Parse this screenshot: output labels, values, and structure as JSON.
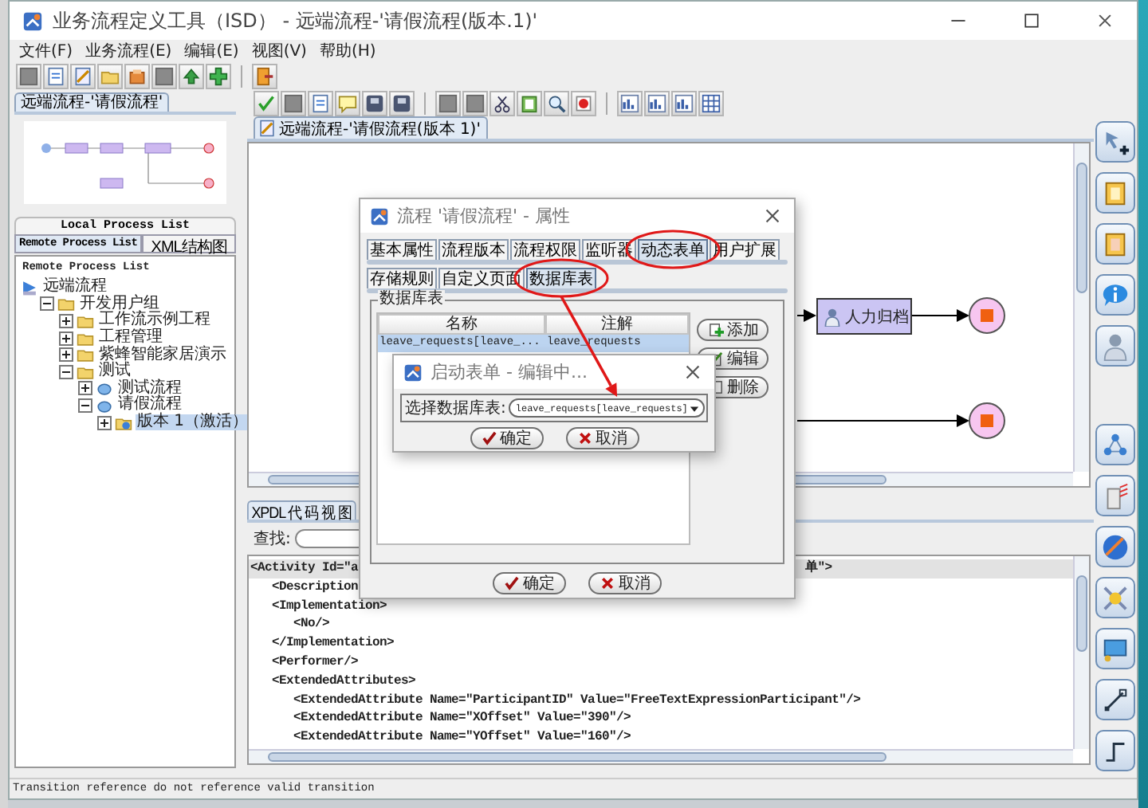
{
  "window": {
    "title": "业务流程定义工具（ISD） - 远端流程-'请假流程(版本.1)'"
  },
  "menu": [
    {
      "label": "文件(F)"
    },
    {
      "label": "业务流程(E)"
    },
    {
      "label": "编辑(E)"
    },
    {
      "label": "视图(V)"
    },
    {
      "label": "帮助(H)"
    }
  ],
  "left_panel": {
    "view_tabs": [
      {
        "label": "远端流程-'请假流程'",
        "selected": true
      }
    ],
    "upper_tabs": [
      {
        "label": "Local Process List",
        "selected": false
      }
    ],
    "tabs": [
      {
        "label": "Remote Process List",
        "selected": true
      },
      {
        "label": "XML结构图",
        "selected": false
      }
    ],
    "list_title": "Remote Process List",
    "tree": [
      {
        "label": "远端流程",
        "kind": "root",
        "expanded": true,
        "selected": false,
        "children": [
          {
            "label": "开发用户组",
            "kind": "group",
            "expanded": true,
            "selected": false,
            "children": [
              {
                "label": "工作流示例工程",
                "kind": "project",
                "expanded": false,
                "selected": false
              },
              {
                "label": "工程管理",
                "kind": "project",
                "expanded": false,
                "selected": false
              },
              {
                "label": "紫蜂智能家居演示",
                "kind": "project",
                "expanded": false,
                "selected": false
              },
              {
                "label": "测试",
                "kind": "project",
                "expanded": true,
                "selected": false,
                "children": [
                  {
                    "label": "测试流程",
                    "kind": "process",
                    "expanded": false,
                    "selected": false
                  },
                  {
                    "label": "请假流程",
                    "kind": "process",
                    "expanded": true,
                    "selected": false,
                    "children": [
                      {
                        "label": "版本 1（激活）",
                        "kind": "version",
                        "expanded": false,
                        "selected": true
                      }
                    ]
                  }
                ]
              }
            ]
          }
        ]
      }
    ]
  },
  "editor": {
    "tabs": [
      {
        "label": "远端流程-'请假流程(版本 1)'",
        "selected": true
      }
    ],
    "nodes": [
      {
        "label": "人力归档",
        "kind": "task"
      }
    ]
  },
  "code_view": {
    "tabs": [
      {
        "label": "XPDL 代 码 视 图",
        "selected": true
      }
    ],
    "search_label": "查找:",
    "lines": [
      {
        "text": "<Activity Id=\"a",
        "tail": "单\">",
        "selected": true
      },
      {
        "text": "   <Description",
        "selected": false
      },
      {
        "text": "   <Implementation>",
        "selected": false
      },
      {
        "text": "      <No/>",
        "selected": false
      },
      {
        "text": "   </Implementation>",
        "selected": false
      },
      {
        "text": "   <Performer/>",
        "selected": false
      },
      {
        "text": "   <ExtendedAttributes>",
        "selected": false
      },
      {
        "text": "      <ExtendedAttribute Name=\"ParticipantID\" Value=\"FreeTextExpressionParticipant\"/>",
        "selected": false
      },
      {
        "text": "      <ExtendedAttribute Name=\"XOffset\" Value=\"390\"/>",
        "selected": false
      },
      {
        "text": "      <ExtendedAttribute Name=\"YOffset\" Value=\"160\"/>",
        "selected": false
      }
    ]
  },
  "status_bar": "Transition reference do not reference valid transition",
  "properties_dialog": {
    "title": "流程 '请假流程' - 属性",
    "tabs": [
      {
        "label": "基本属性",
        "selected": false,
        "circled": false
      },
      {
        "label": "流程版本",
        "selected": false,
        "circled": false
      },
      {
        "label": "流程权限",
        "selected": false,
        "circled": false
      },
      {
        "label": "监听器",
        "selected": false,
        "circled": false
      },
      {
        "label": "动态表单",
        "selected": true,
        "circled": true
      },
      {
        "label": "用户扩展",
        "selected": false,
        "circled": false
      }
    ],
    "subtabs": [
      {
        "label": "存储规则",
        "selected": false,
        "circled": false
      },
      {
        "label": "自定义页面",
        "selected": false,
        "circled": false
      },
      {
        "label": "数据库表",
        "selected": true,
        "circled": true
      }
    ],
    "group_title": "数据库表",
    "table": {
      "columns": [
        "名称",
        "注解"
      ],
      "rows": [
        {
          "cells": [
            "leave_requests[leave_...",
            "leave_requests"
          ],
          "selected": true
        }
      ]
    },
    "side_buttons": [
      {
        "label": "添加",
        "kind": "add"
      },
      {
        "label": "编辑",
        "kind": "edit"
      },
      {
        "label": "删除",
        "kind": "delete"
      }
    ],
    "buttons": [
      {
        "label": "确定",
        "kind": "ok"
      },
      {
        "label": "取消",
        "kind": "cancel"
      }
    ]
  },
  "start_dialog": {
    "title": "启动表单 - 编辑中...",
    "field_label": "选择数据库表:",
    "select_value": "leave_requests[leave_requests]",
    "pointed": true,
    "buttons": [
      {
        "label": "确定",
        "kind": "ok"
      },
      {
        "label": "取消",
        "kind": "cancel"
      }
    ]
  }
}
